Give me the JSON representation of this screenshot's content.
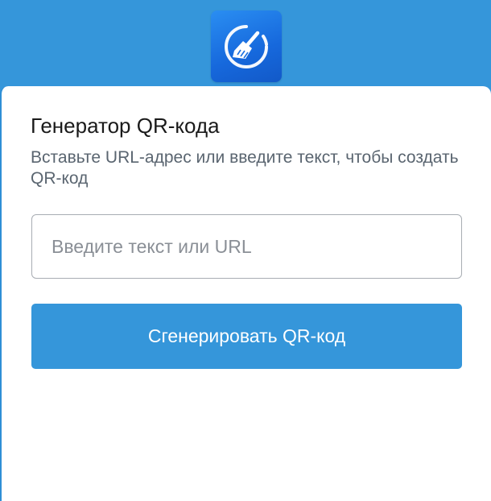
{
  "app": {
    "icon": "broom-icon",
    "colors": {
      "accent": "#3596da",
      "logo_background": "#1a6fe0",
      "card_background": "#ffffff"
    }
  },
  "main": {
    "title": "Генератор QR-кода",
    "subtitle": "Вставьте URL-адрес или введите текст, чтобы создать QR-код",
    "input": {
      "value": "",
      "placeholder": "Введите текст или URL"
    },
    "generate_label": "Сгенерировать QR-код"
  }
}
